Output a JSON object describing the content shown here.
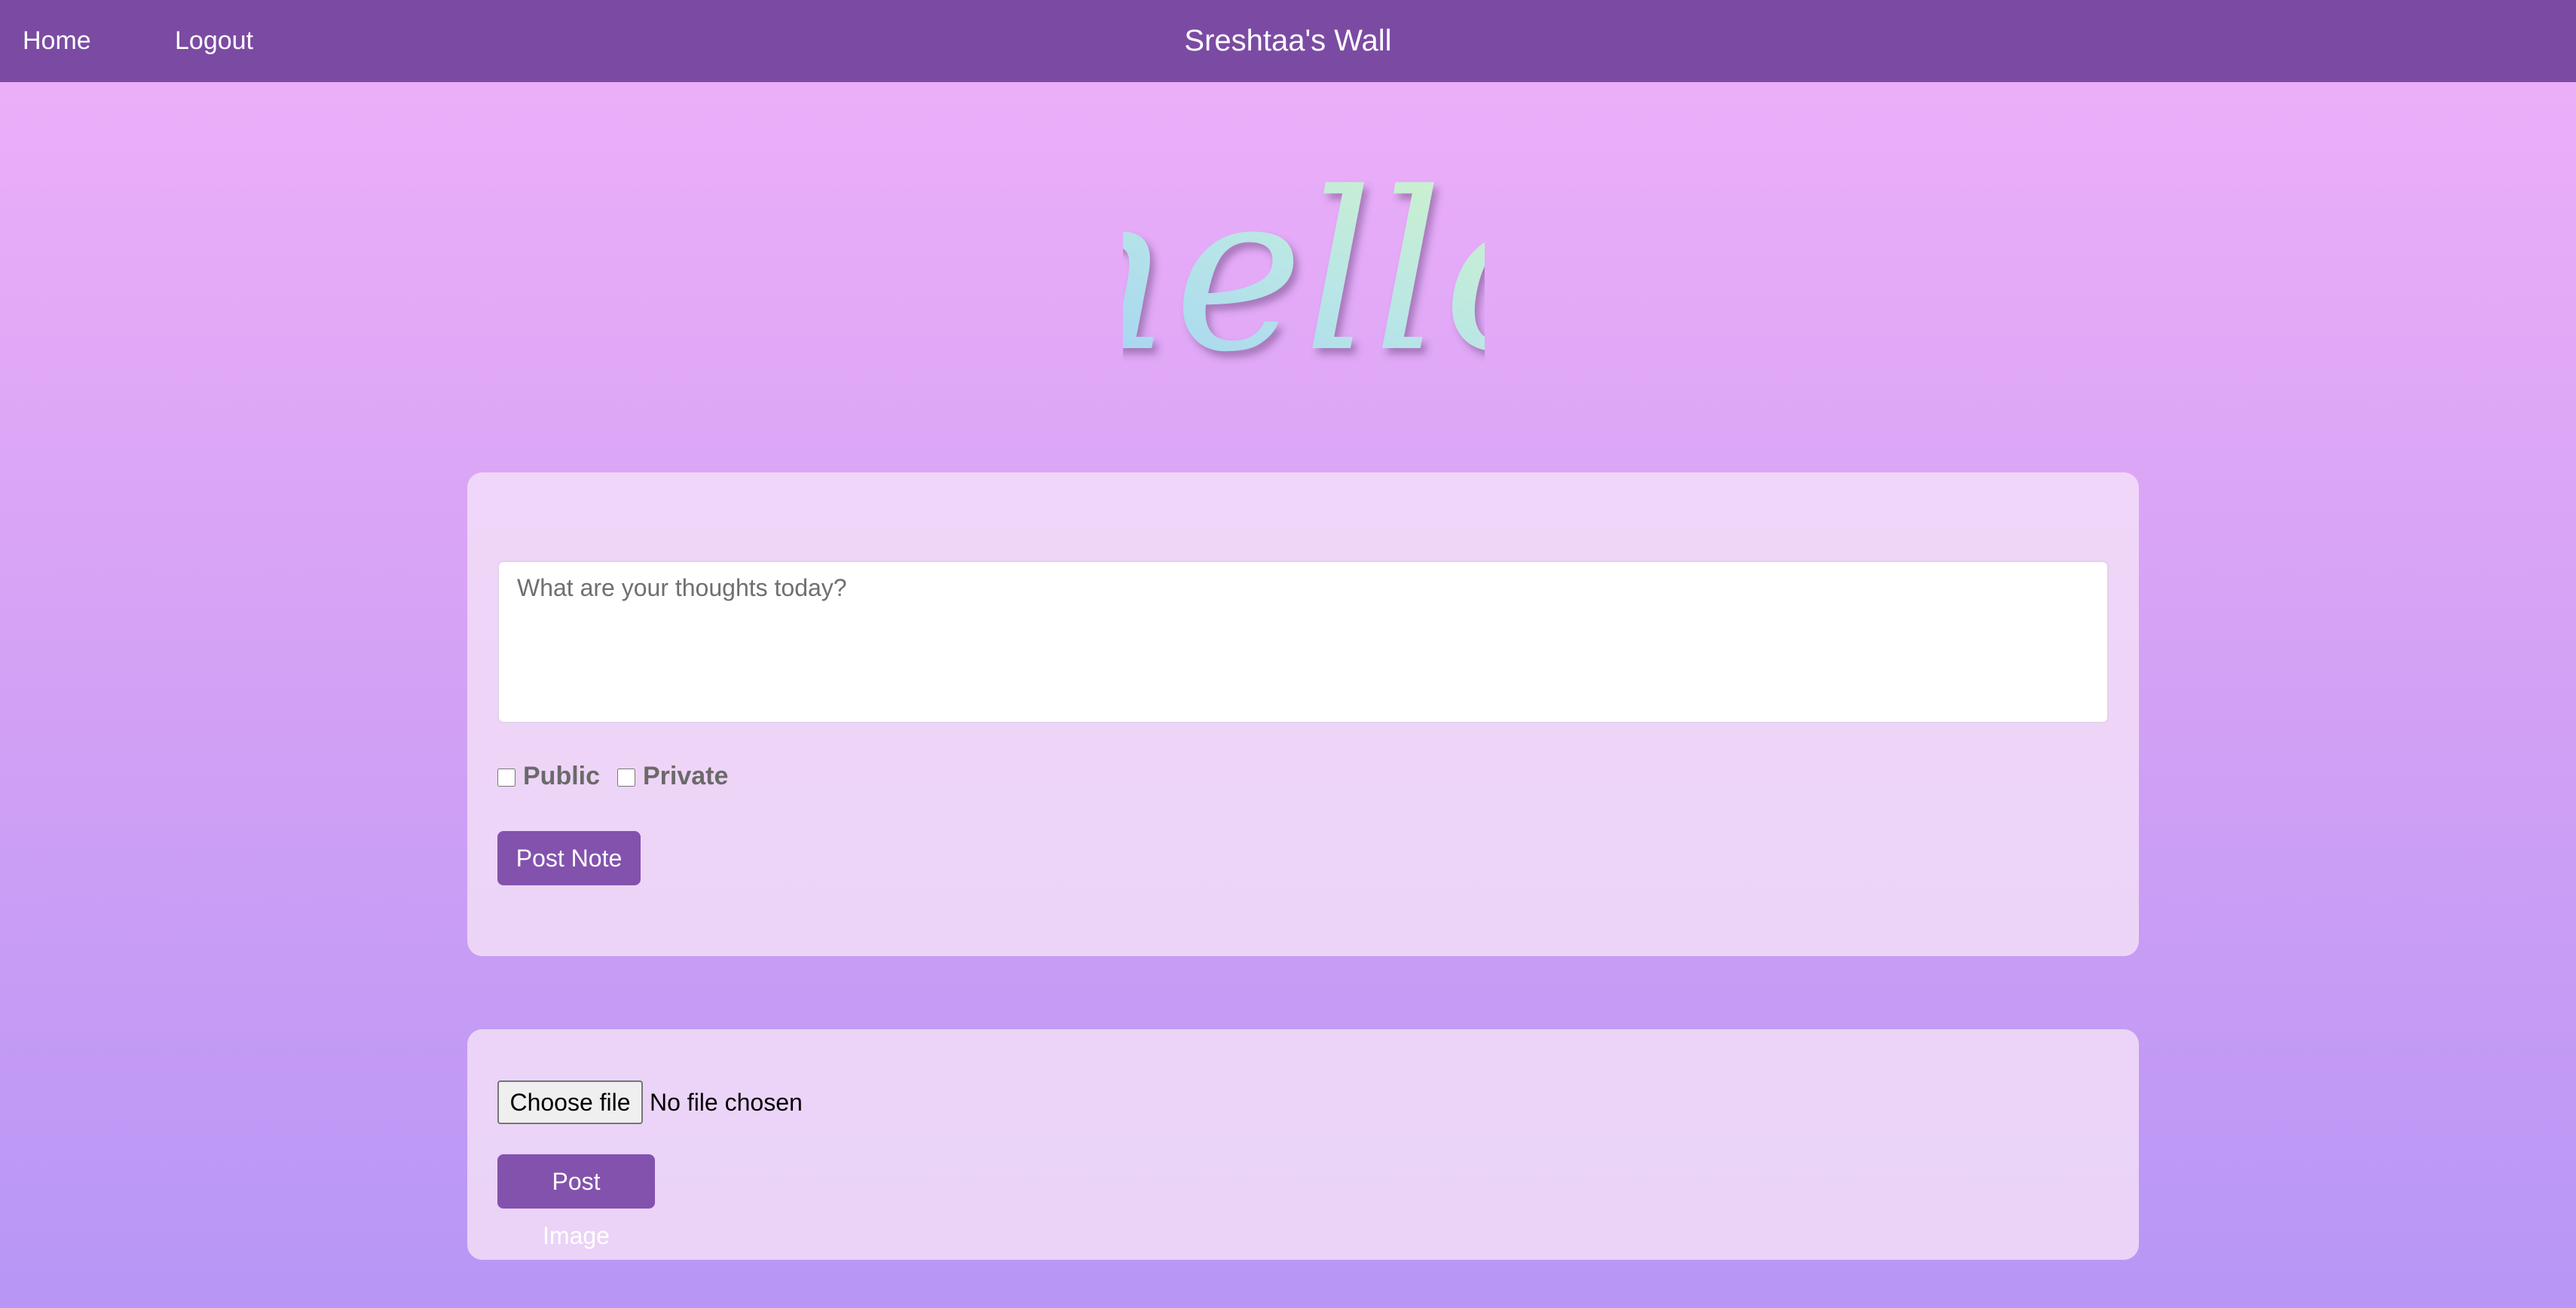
{
  "nav": {
    "home_label": "Home",
    "logout_label": "Logout",
    "title": "Sreshtaa's Wall"
  },
  "hero": {
    "text": "hello"
  },
  "note_form": {
    "placeholder": "What are your thoughts today?",
    "public_label": "Public",
    "private_label": "Private",
    "post_label": "Post Note"
  },
  "image_form": {
    "choose_label": "Choose file",
    "file_status": "No file chosen",
    "post_label": "Post Image"
  },
  "colors": {
    "nav_bg": "#7b4ba3",
    "button_bg": "#8352ad",
    "gradient_top": "#efb0fa",
    "gradient_bottom": "#b796f5"
  }
}
